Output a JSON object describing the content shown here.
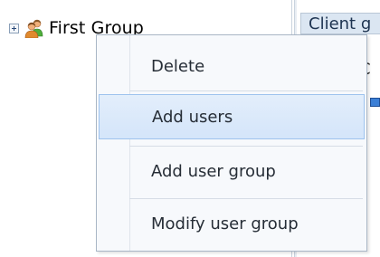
{
  "tree": {
    "group_label": "First Group",
    "expander_icon": "plus-box-icon",
    "group_icon": "user-group-icon"
  },
  "background": {
    "tab_label": "Client g",
    "letter": "C"
  },
  "context_menu": {
    "items": [
      {
        "label": "Delete"
      },
      {
        "label": "Add users",
        "highlighted": true
      },
      {
        "label": "Add user group"
      },
      {
        "label": "Modify user group"
      }
    ]
  },
  "colors": {
    "menu_highlight": "#d4e5fa",
    "menu_highlight_border": "#9ec3ee",
    "menu_background": "#f7f9fc"
  }
}
